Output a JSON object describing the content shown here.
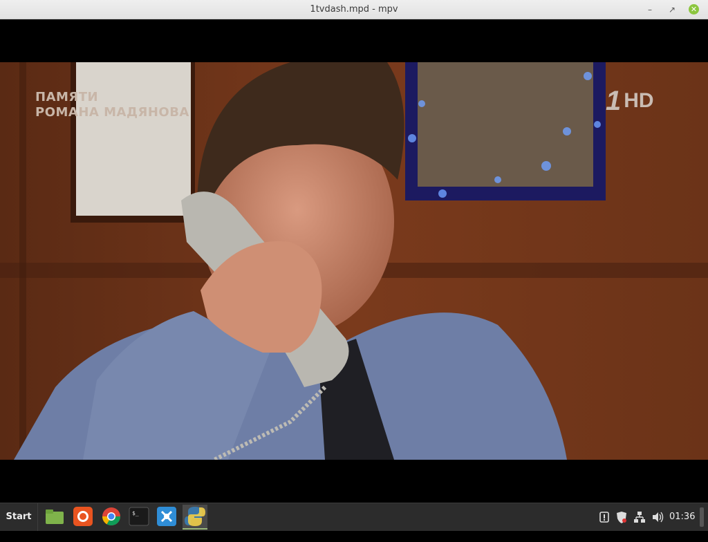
{
  "window": {
    "title": "1tvdash.mpd - mpv",
    "min_icon": "minimize-icon",
    "max_icon": "maximize-icon",
    "close_icon": "close-icon"
  },
  "video": {
    "overlay_line1": "ПАМЯТИ",
    "overlay_line2": "РОМАНА МАДЯНОВА",
    "channel_logo_number": "1",
    "channel_logo_hd": "HD"
  },
  "taskbar": {
    "start_label": "Start",
    "launchers": [
      {
        "name": "files-icon"
      },
      {
        "name": "firefox-icon"
      },
      {
        "name": "chrome-icon"
      },
      {
        "name": "terminal-icon"
      },
      {
        "name": "app-icon"
      },
      {
        "name": "python-icon"
      }
    ],
    "tray_icons": [
      "notification-icon",
      "shield-icon",
      "network-icon",
      "volume-icon"
    ],
    "clock": "01:36"
  }
}
